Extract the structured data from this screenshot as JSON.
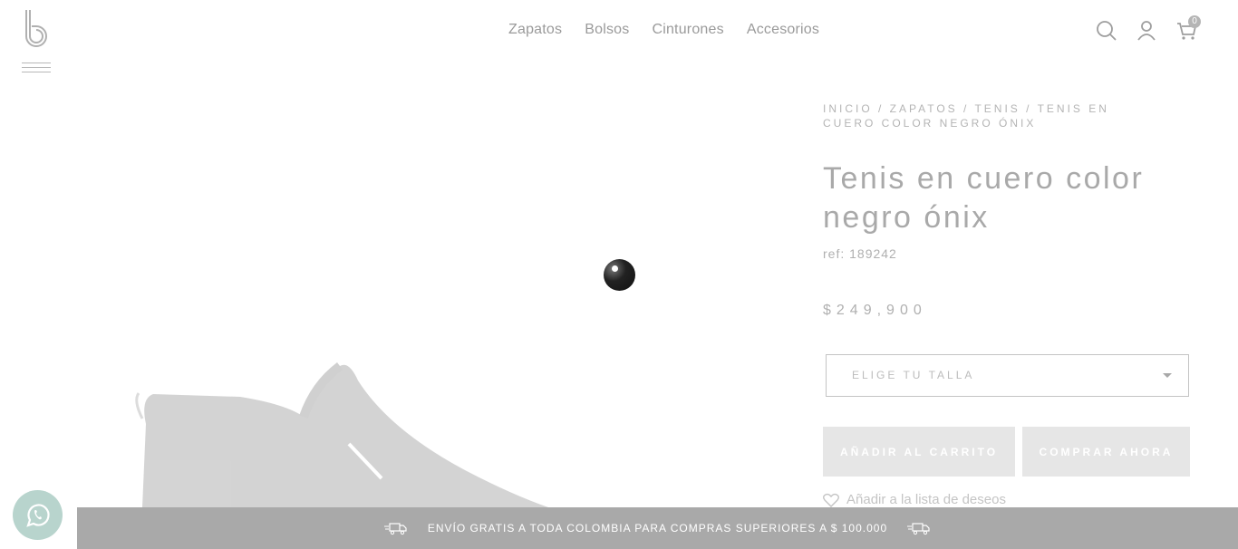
{
  "header": {
    "nav": [
      {
        "label": "Zapatos"
      },
      {
        "label": "Bolsos"
      },
      {
        "label": "Cinturones"
      },
      {
        "label": "Accesorios"
      }
    ],
    "cart_count": "0"
  },
  "product": {
    "breadcrumb": "INICIO / ZAPATOS / TENIS / TENIS EN CUERO COLOR NEGRO ÓNIX",
    "title": "Tenis en cuero color negro ónix",
    "ref": "ref: 189242",
    "price": "$249,900",
    "size_select": "ELIGE TU TALLA",
    "add_to_cart": "AÑADIR AL CARRITO",
    "buy_now": "COMPRAR AHORA",
    "wishlist": "Añadir a la lista de deseos"
  },
  "banner": {
    "text": "ENVÍO GRATIS A TODA COLOMBIA PARA COMPRAS SUPERIORES A $ 100.000"
  },
  "colors": {
    "banner_bg": "#a9a9a9",
    "button_bg": "#e6e6e6",
    "whatsapp": "#b8d4cd"
  }
}
